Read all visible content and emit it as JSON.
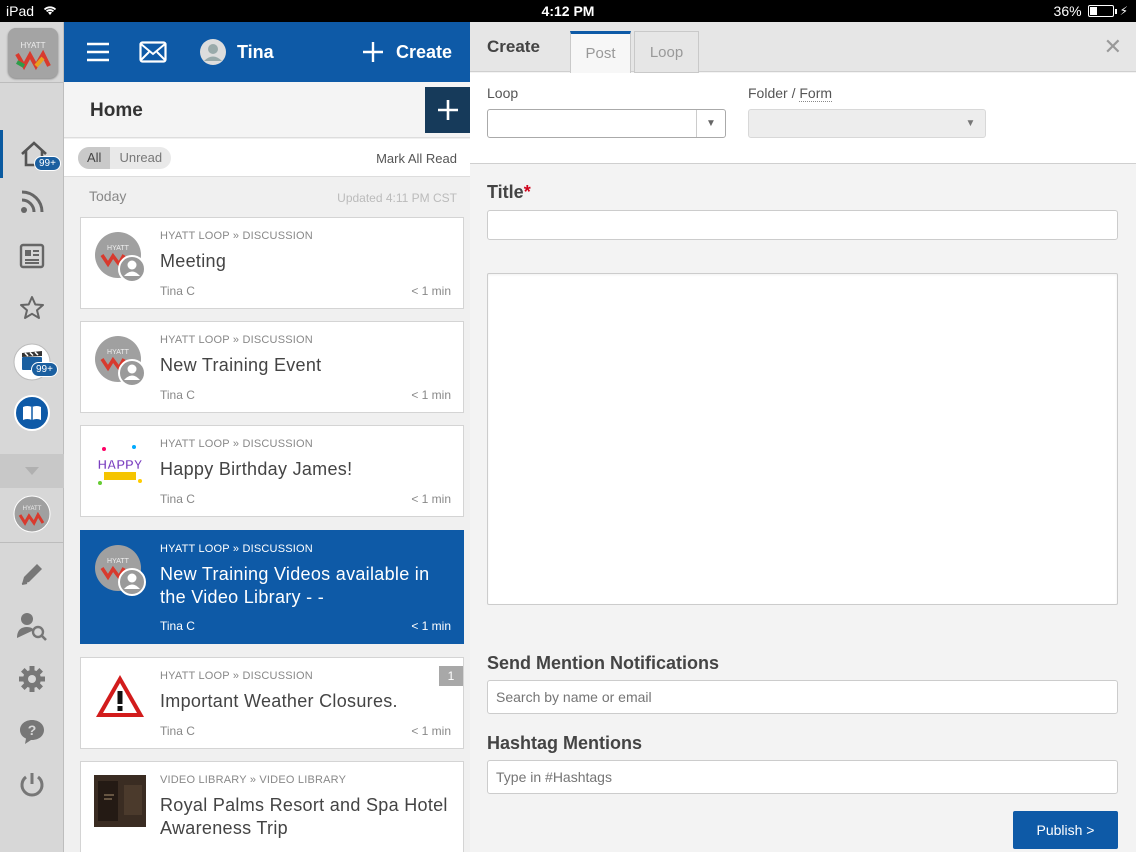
{
  "status_bar": {
    "device": "iPad",
    "time": "4:12 PM",
    "battery": "36%",
    "battery_level": 0.36
  },
  "left_nav": {
    "home_badge": "99+",
    "video_badge": "99+",
    "items": [
      "home-icon",
      "rss-icon",
      "news-icon",
      "star-icon",
      "video-icon",
      "book-icon",
      "chevron-down-icon",
      "hyatt-logo",
      "pencil-icon",
      "user-search-icon",
      "gear-icon",
      "help-icon",
      "power-icon"
    ]
  },
  "topbar": {
    "user_name": "Tina",
    "create_label": "Create"
  },
  "home": {
    "title": "Home"
  },
  "filter": {
    "all": "All",
    "unread": "Unread",
    "mark_all_read": "Mark All Read"
  },
  "day": {
    "label": "Today",
    "updated": "Updated 4:11 PM CST"
  },
  "feed": [
    {
      "meta": "HYATT LOOP » DISCUSSION",
      "title": "Meeting",
      "author": "Tina C",
      "time": "< 1 min"
    },
    {
      "meta": "HYATT LOOP » DISCUSSION",
      "title": "New Training Event",
      "author": "Tina C",
      "time": "< 1 min"
    },
    {
      "meta": "HYATT LOOP » DISCUSSION",
      "title": "Happy Birthday James!",
      "author": "Tina C",
      "time": "< 1 min",
      "thumb_text": "HAPPY"
    },
    {
      "meta": "HYATT LOOP » DISCUSSION",
      "title": "New Training Videos available in the Video Library - -",
      "author": "Tina C",
      "time": "< 1 min"
    },
    {
      "meta": "HYATT LOOP » DISCUSSION",
      "title": "Important Weather Closures.",
      "author": "Tina C",
      "time": "< 1 min",
      "count": "1"
    },
    {
      "meta": "VIDEO LIBRARY » VIDEO LIBRARY",
      "title": "Royal Palms Resort and Spa Hotel Awareness Trip"
    }
  ],
  "create_panel": {
    "title": "Create",
    "tabs": [
      "Post",
      "Loop"
    ],
    "active_tab": "Post",
    "close": "✕",
    "loop_label": "Loop",
    "folder_label": "Folder",
    "folder_sep": " / ",
    "form_label": "Form",
    "title_label": "Title",
    "required_mark": "*",
    "mentions_label": "Send Mention Notifications",
    "mentions_placeholder": "Search by name or email",
    "hashtags_label": "Hashtag Mentions",
    "hashtags_placeholder": "Type in #Hashtags",
    "publish_label": "Publish >"
  },
  "colors": {
    "brand_blue": "#0e5aa7",
    "dark_navy": "#163a5a",
    "required_red": "#d0021b"
  }
}
